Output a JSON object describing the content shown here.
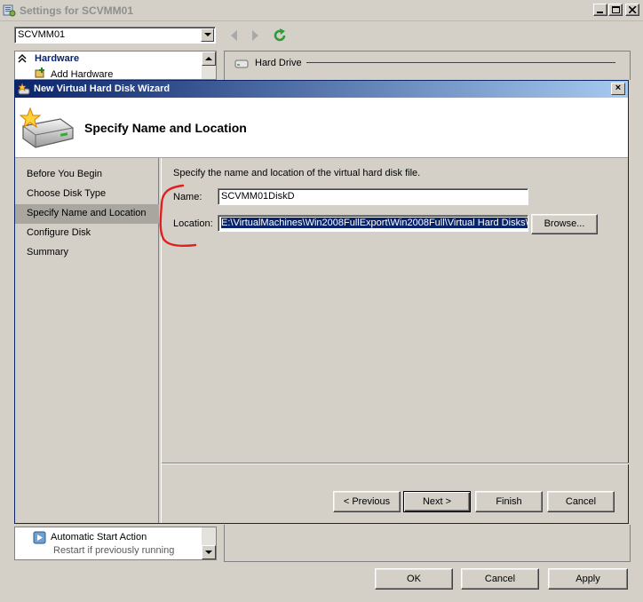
{
  "window": {
    "title": "Settings for SCVMM01",
    "vm_select_value": "SCVMM01"
  },
  "hardware_panel": {
    "header": "Hardware",
    "first_item": "Add Hardware"
  },
  "details_panel": {
    "section_title": "Hard Drive"
  },
  "bottom_list": {
    "item_title": "Automatic Start Action",
    "item_subtitle": "Restart if previously running"
  },
  "dialog_buttons": {
    "ok": "OK",
    "cancel": "Cancel",
    "apply": "Apply"
  },
  "wizard": {
    "title": "New Virtual Hard Disk Wizard",
    "close_glyph": "×",
    "page_heading": "Specify Name and Location",
    "steps": [
      {
        "label": "Before You Begin"
      },
      {
        "label": "Choose Disk Type"
      },
      {
        "label": "Specify Name and Location",
        "selected": true
      },
      {
        "label": "Configure Disk"
      },
      {
        "label": "Summary"
      }
    ],
    "instruction": "Specify the name and location of the virtual hard disk file.",
    "name_label": "Name:",
    "name_value": "SCVMM01DiskD",
    "location_label": "Location:",
    "location_value": "E:\\VirtualMachines\\Win2008FullExport\\Win2008Full\\Virtual Hard Disks\\",
    "browse_label": "Browse...",
    "buttons": {
      "previous": "< Previous",
      "next": "Next >",
      "finish": "Finish",
      "cancel": "Cancel"
    }
  },
  "colors": {
    "title_bar_start": "#0a246a",
    "title_bar_end": "#a6caf0",
    "selection": "#0a246a",
    "annotation_red": "#e02020",
    "window_face": "#d4d0c8"
  },
  "icons": {
    "app": "vm-settings-icon",
    "back": "back-arrow-icon",
    "forward": "forward-arrow-icon",
    "refresh": "refresh-icon",
    "collapse": "collapse-chevron-icon",
    "add_hardware": "add-hardware-icon",
    "hard_drive": "hard-drive-icon",
    "wizard": "new-disk-wizard-icon",
    "start_action": "start-action-icon"
  }
}
